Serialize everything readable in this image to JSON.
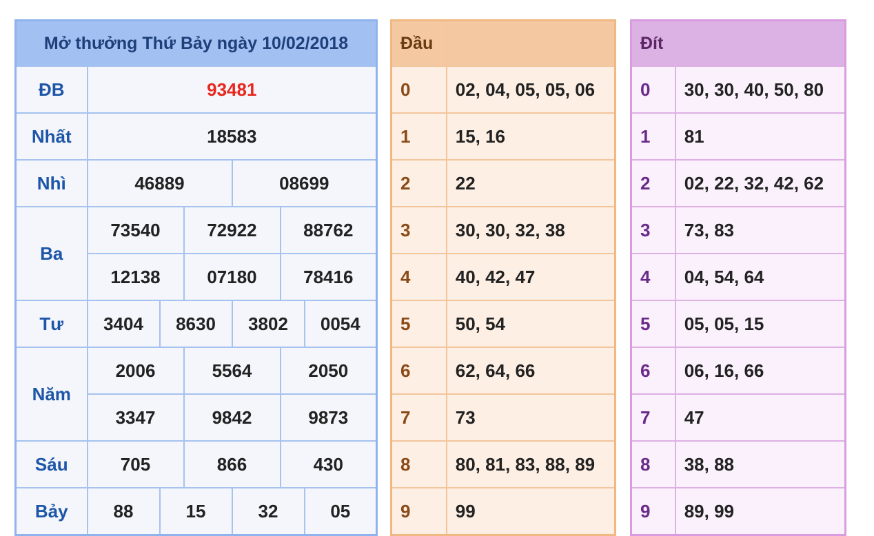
{
  "results": {
    "title": "Mở thưởng Thứ Bảy ngày 10/02/2018",
    "db": {
      "label": "ĐB",
      "value": "93481"
    },
    "nhat": {
      "label": "Nhất",
      "value": "18583"
    },
    "nhi": {
      "label": "Nhì",
      "values": [
        "46889",
        "08699"
      ]
    },
    "ba": {
      "label": "Ba",
      "values": [
        "73540",
        "72922",
        "88762",
        "12138",
        "07180",
        "78416"
      ]
    },
    "tu": {
      "label": "Tư",
      "values": [
        "3404",
        "8630",
        "3802",
        "0054"
      ]
    },
    "nam": {
      "label": "Năm",
      "values": [
        "2006",
        "5564",
        "2050",
        "3347",
        "9842",
        "9873"
      ]
    },
    "sau": {
      "label": "Sáu",
      "values": [
        "705",
        "866",
        "430"
      ]
    },
    "bay": {
      "label": "Bảy",
      "values": [
        "88",
        "15",
        "32",
        "05"
      ]
    }
  },
  "dau": {
    "header": "Đầu",
    "rows": [
      {
        "digit": "0",
        "values": "02, 04, 05, 05, 06"
      },
      {
        "digit": "1",
        "values": "15, 16"
      },
      {
        "digit": "2",
        "values": "22"
      },
      {
        "digit": "3",
        "values": "30, 30, 32, 38"
      },
      {
        "digit": "4",
        "values": "40, 42, 47"
      },
      {
        "digit": "5",
        "values": "50, 54"
      },
      {
        "digit": "6",
        "values": "62, 64, 66"
      },
      {
        "digit": "7",
        "values": "73"
      },
      {
        "digit": "8",
        "values": "80, 81, 83, 88, 89"
      },
      {
        "digit": "9",
        "values": "99"
      }
    ]
  },
  "dit": {
    "header": "Đít",
    "rows": [
      {
        "digit": "0",
        "values": "30, 30, 40, 50, 80"
      },
      {
        "digit": "1",
        "values": "81"
      },
      {
        "digit": "2",
        "values": "02, 22, 32, 42, 62"
      },
      {
        "digit": "3",
        "values": "73, 83"
      },
      {
        "digit": "4",
        "values": "04, 54, 64"
      },
      {
        "digit": "5",
        "values": "05, 05, 15"
      },
      {
        "digit": "6",
        "values": "06, 16, 66"
      },
      {
        "digit": "7",
        "values": "47"
      },
      {
        "digit": "8",
        "values": "38, 88"
      },
      {
        "digit": "9",
        "values": "89, 99"
      }
    ]
  },
  "colors": {
    "special_prize": "#e8271e",
    "results_header": "#a2c0f2",
    "dau_header": "#f4c9a2",
    "dit_header": "#dcb1e3"
  }
}
